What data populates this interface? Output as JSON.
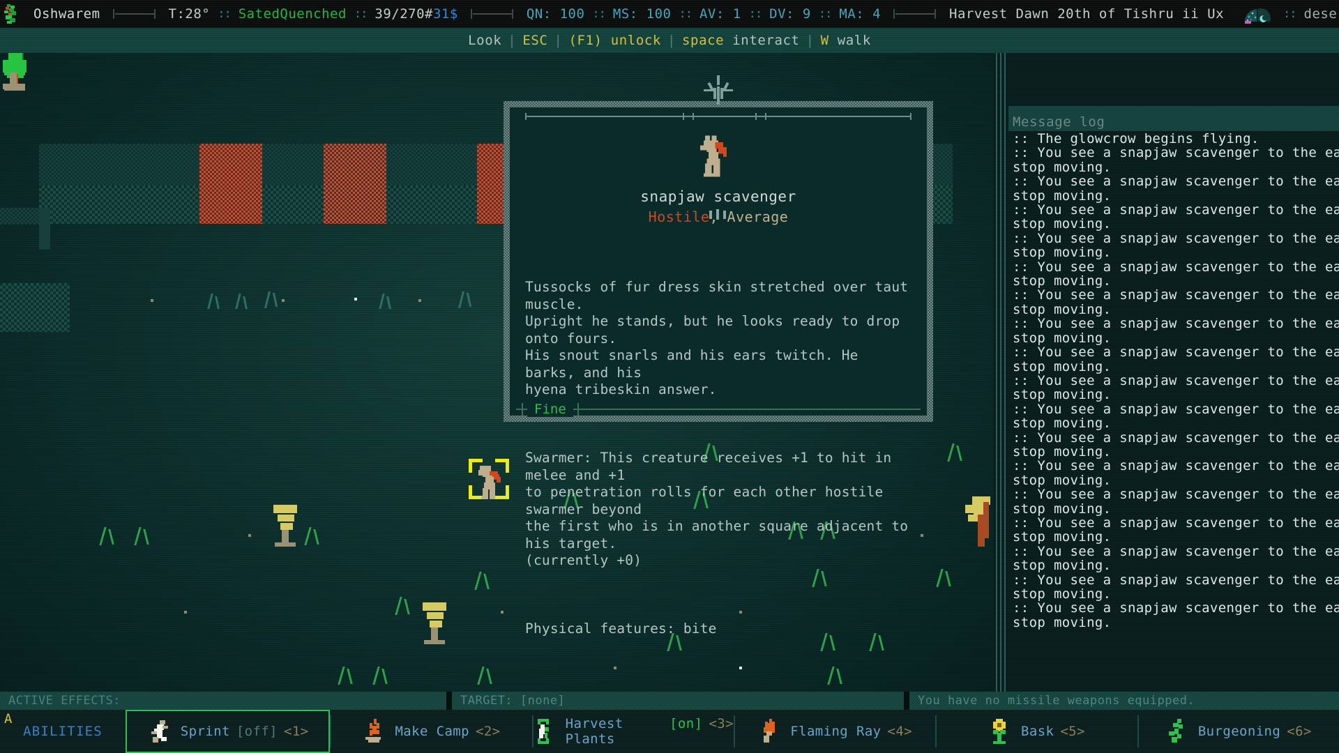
{
  "topbar": {
    "player_name": "Oshwarem",
    "temperature": "T:28°",
    "status_sated": "Sated",
    "status_quenched": "Quenched",
    "weight": "39/270#",
    "money": "31$",
    "qn": "QN: 100",
    "ms": "MS: 100",
    "av": "AV: 1",
    "dv": "DV: 9",
    "ma": "MA: 4",
    "datetime": "Harvest Dawn 20th of Tishru ii Ux",
    "location": "desert canyon, surface",
    "separator_dots": "::"
  },
  "hints": {
    "look": "Look",
    "esc": "ESC",
    "f1": "(F1)",
    "unlock": "unlock",
    "space": "space",
    "interact": "interact",
    "w": "W",
    "walk": "walk",
    "divider": "|"
  },
  "tooltip": {
    "creature_name": "snapjaw scavenger",
    "disposition": "Hostile",
    "difficulty": "Average",
    "comma": ", ",
    "description": "Tussocks of fur dress skin stretched over taut muscle.\nUpright he stands, but he looks ready to drop onto fours.\nHis snout snarls and his ears twitch. He barks, and his\nhyena tribeskin answer.",
    "swarmer": "Swarmer: This creature receives +1 to hit in melee and +1\nto penetration rolls for each other hostile swarmer beyond\nthe first who is in another square adjacent to his target.\n(currently +0)",
    "physical_features": "Physical features: bite",
    "health_status": "Fine"
  },
  "message_log": {
    "title": "Message log",
    "lines": [
      ":: The glowcrow begins flying.",
      ":: You see a snapjaw scavenger to the east and",
      "stop moving.",
      ":: You see a snapjaw scavenger to the east and",
      "stop moving.",
      ":: You see a snapjaw scavenger to the east and",
      "stop moving.",
      ":: You see a snapjaw scavenger to the east and",
      "stop moving.",
      ":: You see a snapjaw scavenger to the east and",
      "stop moving.",
      ":: You see a snapjaw scavenger to the east and",
      "stop moving.",
      ":: You see a snapjaw scavenger to the east and",
      "stop moving.",
      ":: You see a snapjaw scavenger to the east and",
      "stop moving.",
      ":: You see a snapjaw scavenger to the east and",
      "stop moving.",
      ":: You see a snapjaw scavenger to the east and",
      "stop moving.",
      ":: You see a snapjaw scavenger to the east and",
      "stop moving.",
      ":: You see a snapjaw scavenger to the east and",
      "stop moving.",
      ":: You see a snapjaw scavenger to the east and",
      "stop moving.",
      ":: You see a snapjaw scavenger to the east and",
      "stop moving.",
      ":: You see a snapjaw scavenger to the east and",
      "stop moving.",
      ":: You see a snapjaw scavenger to the east and",
      "stop moving.",
      ":: You see a snapjaw scavenger to the east and",
      "stop moving."
    ]
  },
  "effects_bar": {
    "active_effects_label": "ACTIVE EFFECTS:",
    "target_label": "TARGET: [none]",
    "missile_label": "You have no missile weapons equipped."
  },
  "abilities": {
    "hotkey_letter": "A",
    "label": "ABILITIES",
    "slots": [
      {
        "name": "Sprint",
        "state": "[off]",
        "key": "<1>",
        "icon": "running-figure-icon",
        "selected": true,
        "state_on": false
      },
      {
        "name": "Make Camp",
        "state": "",
        "key": "<2>",
        "icon": "campfire-icon",
        "selected": false,
        "state_on": false
      },
      {
        "name": "Harvest Plants",
        "state": "[on]",
        "key": "<3>",
        "icon": "harvest-icon",
        "selected": false,
        "state_on": true
      },
      {
        "name": "Flaming Ray",
        "state": "",
        "key": "<4>",
        "icon": "flame-icon",
        "selected": false,
        "state_on": false
      },
      {
        "name": "Bask",
        "state": "",
        "key": "<5>",
        "icon": "sunflower-icon",
        "selected": false,
        "state_on": false
      },
      {
        "name": "Burgeoning",
        "state": "",
        "key": "<6>",
        "icon": "vine-icon",
        "selected": false,
        "state_on": false
      }
    ]
  },
  "colors": {
    "accent_green": "#2fc04e",
    "hostile_red": "#d1481f",
    "panel_bg": "#0b2b2a",
    "map_bg": "#0d3330",
    "topbar_bg": "#0b0d0d",
    "hint_bg": "#12413c",
    "yellow_key": "#d2c040",
    "blue_money": "#2b8ae0"
  }
}
